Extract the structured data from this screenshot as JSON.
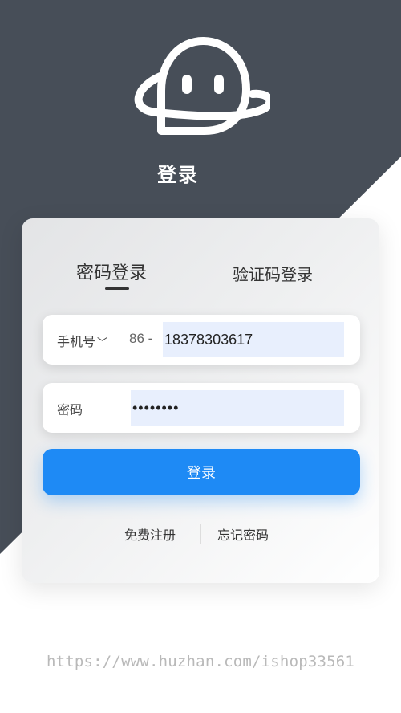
{
  "header": {
    "title": "登录"
  },
  "tabs": [
    {
      "label": "密码登录",
      "active": true
    },
    {
      "label": "验证码登录",
      "active": false
    }
  ],
  "phone_field": {
    "label": "手机号",
    "country_code": "86 -",
    "value": "18378303617"
  },
  "password_field": {
    "label": "密码",
    "value": "••••••••"
  },
  "login_button": {
    "label": "登录"
  },
  "links": {
    "register": "免费注册",
    "forgot": "忘记密码"
  },
  "watermark": {
    "text": "https://www.huzhan.com/ishop33561"
  },
  "colors": {
    "header_bg": "#474e58",
    "accent": "#1e8af5",
    "input_bg": "#e8effd"
  }
}
